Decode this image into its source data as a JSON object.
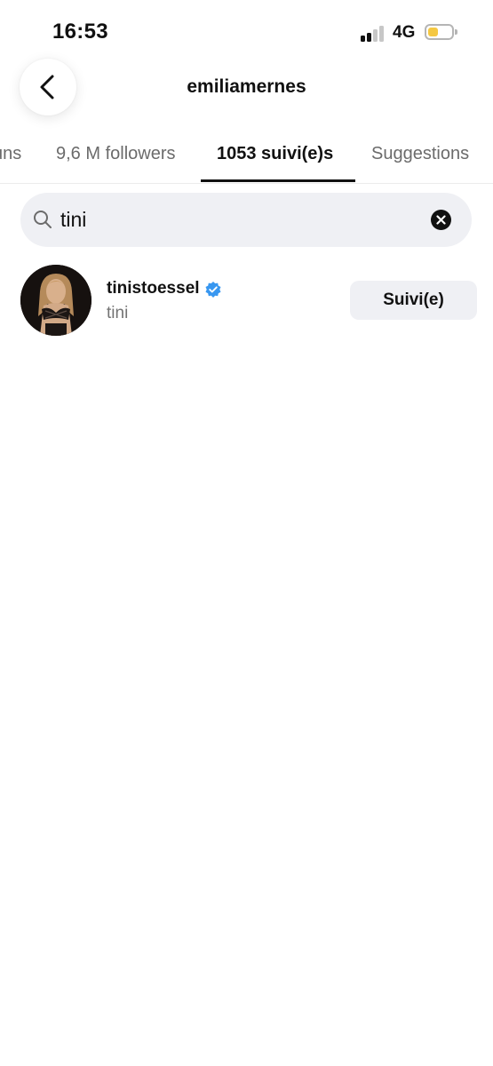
{
  "status_bar": {
    "time": "16:53",
    "network": "4G",
    "battery_color": "#f5c842",
    "battery_level": 0.35,
    "signal_bars_active": 2,
    "signal_bars_total": 4
  },
  "header": {
    "title": "emiliamernes",
    "back_icon": "chevron-left-icon"
  },
  "tabs": [
    {
      "label": "uns",
      "active": false
    },
    {
      "label": "9,6 M followers",
      "active": false
    },
    {
      "label": "1053 suivi(e)s",
      "active": true
    },
    {
      "label": "Suggestions",
      "active": false
    }
  ],
  "search": {
    "value": "tini",
    "icon": "search-icon",
    "clear_icon": "clear-icon"
  },
  "results": [
    {
      "username": "tinistoessel",
      "full_name": "tini",
      "verified": true,
      "verified_color": "#3897f0",
      "button_label": "Suivi(e)"
    }
  ]
}
